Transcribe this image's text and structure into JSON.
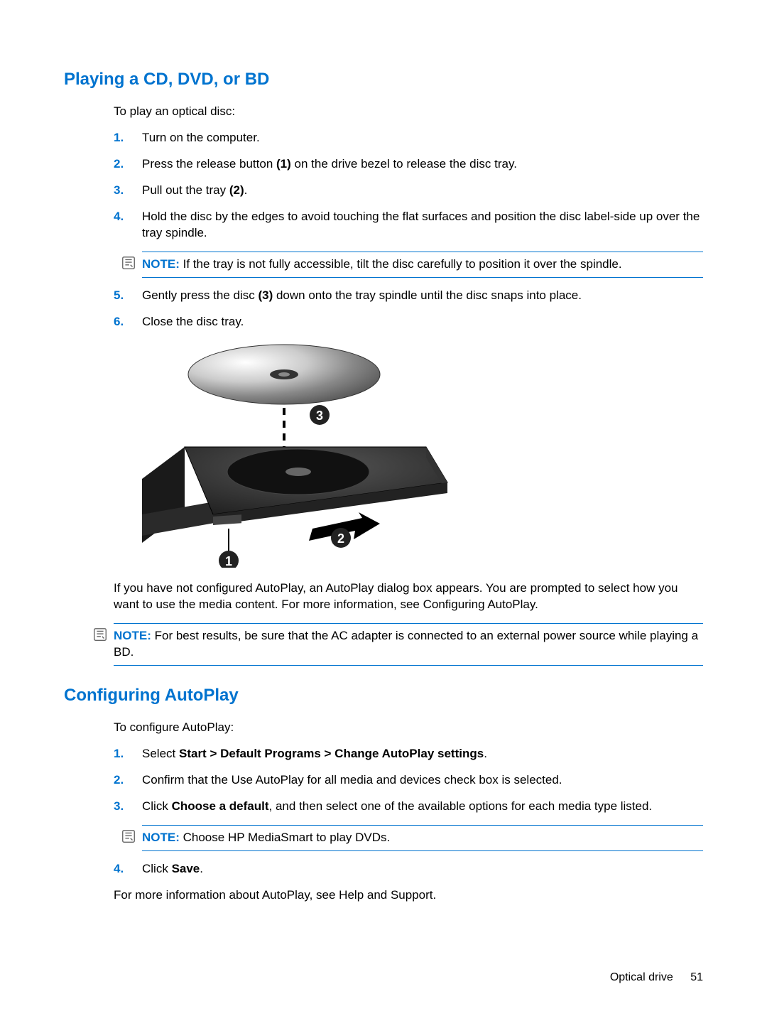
{
  "section1": {
    "heading": "Playing a CD, DVD, or BD",
    "intro": "To play an optical disc:",
    "steps": {
      "s1": "Turn on the computer.",
      "s2a": "Press the release button ",
      "s2b": "(1)",
      "s2c": " on the drive bezel to release the disc tray.",
      "s3a": "Pull out the tray ",
      "s3b": "(2)",
      "s3c": ".",
      "s4": "Hold the disc by the edges to avoid touching the flat surfaces and position the disc label-side up over the tray spindle.",
      "s5a": "Gently press the disc ",
      "s5b": "(3)",
      "s5c": " down onto the tray spindle until the disc snaps into place.",
      "s6": "Close the disc tray."
    },
    "note1": {
      "label": "NOTE:",
      "text": "If the tray is not fully accessible, tilt the disc carefully to position it over the spindle."
    },
    "afterFigure": "If you have not configured AutoPlay, an AutoPlay dialog box appears. You are prompted to select how you want to use the media content. For more information, see Configuring AutoPlay.",
    "note2": {
      "label": "NOTE:",
      "text": "For best results, be sure that the AC adapter is connected to an external power source while playing a BD."
    }
  },
  "section2": {
    "heading": "Configuring AutoPlay",
    "intro": "To configure AutoPlay:",
    "steps": {
      "s1a": "Select ",
      "s1b": "Start > Default Programs > Change AutoPlay settings",
      "s1c": ".",
      "s2": "Confirm that the Use AutoPlay for all media and devices check box is selected.",
      "s3a": "Click ",
      "s3b": "Choose a default",
      "s3c": ", and then select one of the available options for each media type listed.",
      "s4a": "Click ",
      "s4b": "Save",
      "s4c": "."
    },
    "note": {
      "label": "NOTE:",
      "text": "Choose HP MediaSmart to play DVDs."
    },
    "closing": "For more information about AutoPlay, see Help and Support."
  },
  "footer": {
    "label": "Optical drive",
    "page": "51"
  },
  "nums": {
    "n1": "1.",
    "n2": "2.",
    "n3": "3.",
    "n4": "4.",
    "n5": "5.",
    "n6": "6."
  }
}
